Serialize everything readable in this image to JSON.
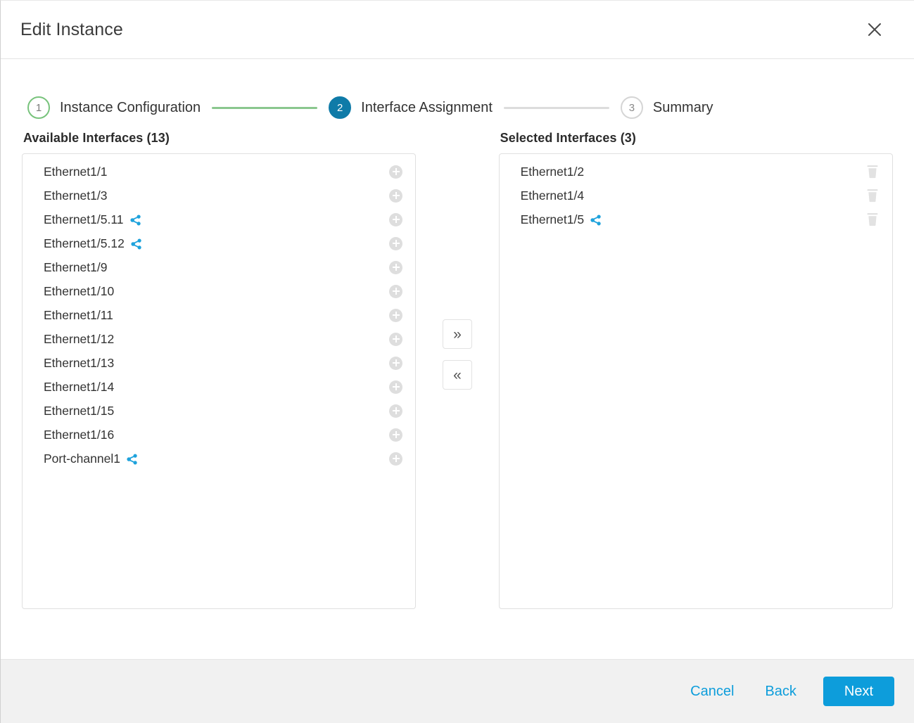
{
  "dialog": {
    "title": "Edit Instance",
    "close_icon": "close-icon"
  },
  "stepper": {
    "steps": [
      {
        "number": "1",
        "label": "Instance Configuration",
        "state": "done"
      },
      {
        "number": "2",
        "label": "Interface Assignment",
        "state": "current"
      },
      {
        "number": "3",
        "label": "Summary",
        "state": "todo"
      }
    ],
    "colors": {
      "done_accent": "#78c37c",
      "current_accent": "#0f7ba8",
      "todo_accent": "#d5d5d5"
    }
  },
  "available": {
    "title": "Available Interfaces (13)",
    "action_icon": "plus-circle-icon",
    "items": [
      {
        "name": "Ethernet1/1",
        "shared": false
      },
      {
        "name": "Ethernet1/3",
        "shared": false
      },
      {
        "name": "Ethernet1/5.11",
        "shared": true
      },
      {
        "name": "Ethernet1/5.12",
        "shared": true
      },
      {
        "name": "Ethernet1/9",
        "shared": false
      },
      {
        "name": "Ethernet1/10",
        "shared": false
      },
      {
        "name": "Ethernet1/11",
        "shared": false
      },
      {
        "name": "Ethernet1/12",
        "shared": false
      },
      {
        "name": "Ethernet1/13",
        "shared": false
      },
      {
        "name": "Ethernet1/14",
        "shared": false
      },
      {
        "name": "Ethernet1/15",
        "shared": false
      },
      {
        "name": "Ethernet1/16",
        "shared": false
      },
      {
        "name": "Port-channel1",
        "shared": true
      }
    ]
  },
  "selected": {
    "title": "Selected Interfaces (3)",
    "action_icon": "trash-icon",
    "items": [
      {
        "name": "Ethernet1/2",
        "shared": false
      },
      {
        "name": "Ethernet1/4",
        "shared": false
      },
      {
        "name": "Ethernet1/5",
        "shared": true
      }
    ]
  },
  "transfer": {
    "add_all_label": "»",
    "remove_all_label": "«"
  },
  "footer": {
    "cancel_label": "Cancel",
    "back_label": "Back",
    "next_label": "Next",
    "primary_color": "#0d9ddb",
    "link_color": "#0d9ddb"
  }
}
